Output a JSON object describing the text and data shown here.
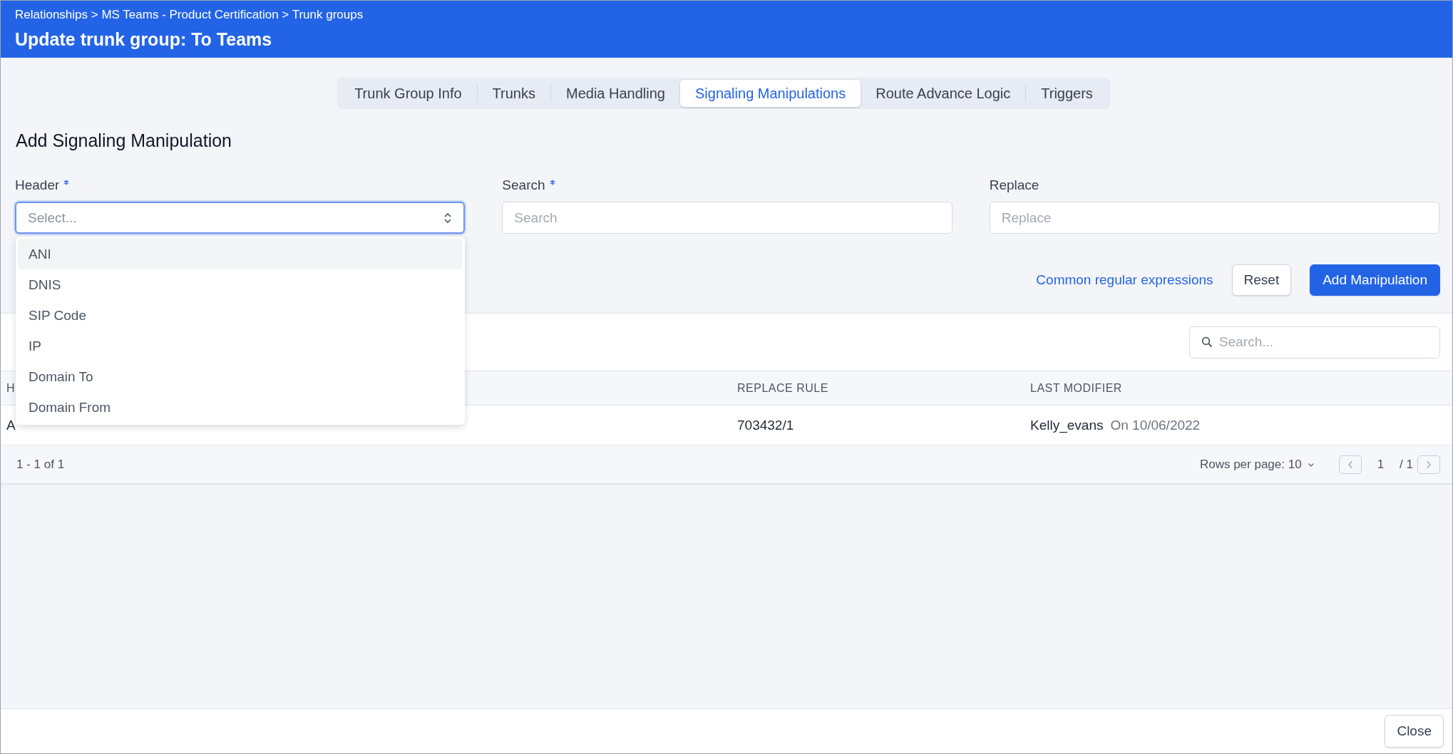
{
  "header": {
    "breadcrumb": "Relationships > MS Teams - Product Certification > Trunk groups",
    "title": "Update trunk group: To Teams"
  },
  "tabs": [
    {
      "label": "Trunk Group Info",
      "selected": false
    },
    {
      "label": "Trunks",
      "selected": false
    },
    {
      "label": "Media Handling",
      "selected": false
    },
    {
      "label": "Signaling Manipulations",
      "selected": true
    },
    {
      "label": "Route Advance Logic",
      "selected": false
    },
    {
      "label": "Triggers",
      "selected": false
    }
  ],
  "form": {
    "title": "Add Signaling Manipulation",
    "fields": [
      {
        "kind": "select",
        "label": "Header",
        "required": true,
        "placeholder": "Select...",
        "focused": true
      },
      {
        "kind": "text",
        "label": "Search",
        "required": true,
        "placeholder": "Search",
        "focused": false
      },
      {
        "kind": "text",
        "label": "Replace",
        "required": false,
        "placeholder": "Replace",
        "focused": false
      }
    ],
    "link": "Common regular expressions",
    "reset_button": "Reset",
    "add_button": "Add Manipulation"
  },
  "dropdown": {
    "options": [
      {
        "label": "ANI",
        "selected": true
      },
      {
        "label": "DNIS",
        "selected": false
      },
      {
        "label": "SIP Code",
        "selected": false
      },
      {
        "label": "IP",
        "selected": false
      },
      {
        "label": "Domain To",
        "selected": false
      },
      {
        "label": "Domain From",
        "selected": false
      }
    ]
  },
  "table": {
    "search_placeholder": "Search...",
    "columns": [
      "H",
      "REPLACE RULE",
      "LAST MODIFIER"
    ],
    "rows": [
      {
        "column_1": "A",
        "replace_rule": "703432/1",
        "modifier": "Kelly_evans",
        "date": "On 10/06/2022"
      }
    ],
    "range": "1 - 1 of 1",
    "rows_per_page": "Rows per page: 10",
    "page": "1",
    "pages": "/ 1"
  },
  "footer": {
    "close_button": "Close"
  }
}
